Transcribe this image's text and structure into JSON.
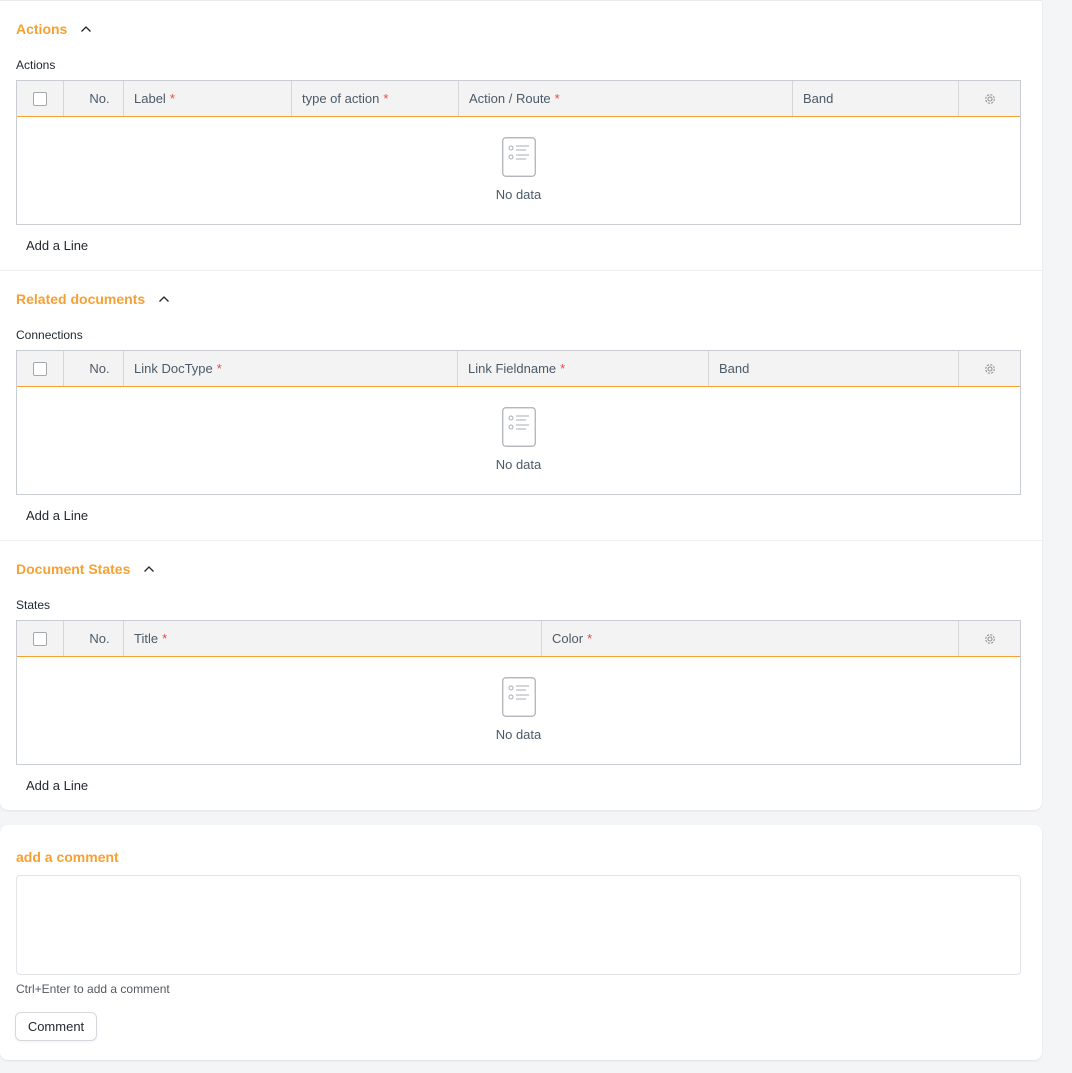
{
  "sections": [
    {
      "title": "Actions",
      "field_label": "Actions",
      "columns": [
        {
          "label": "Label",
          "required": "*"
        },
        {
          "label": "type of action",
          "required": "*"
        },
        {
          "label": "Action / Route",
          "required": "*"
        },
        {
          "label": "Band",
          "required": ""
        }
      ]
    },
    {
      "title": "Related documents",
      "field_label": "Connections",
      "columns": [
        {
          "label": "Link DocType",
          "required": "*"
        },
        {
          "label": "Link Fieldname",
          "required": "*"
        },
        {
          "label": "Band",
          "required": ""
        }
      ]
    },
    {
      "title": "Document States",
      "field_label": "States",
      "columns": [
        {
          "label": "Title",
          "required": "*"
        },
        {
          "label": "Color",
          "required": "*"
        }
      ]
    }
  ],
  "grid": {
    "no_label": "No.",
    "empty_text": "No data",
    "add_line_label": "Add a Line",
    "settings_icon": "gear-icon",
    "empty_icon": "empty-list-icon",
    "collapse_icon": "chevron-up-icon"
  },
  "comment": {
    "title": "add a comment",
    "placeholder": "",
    "hint": "Ctrl+Enter to add a comment",
    "button_label": "Comment"
  },
  "colors": {
    "accent": "#f7a033",
    "required": "#e24c4c",
    "background": "#f4f5f7"
  }
}
